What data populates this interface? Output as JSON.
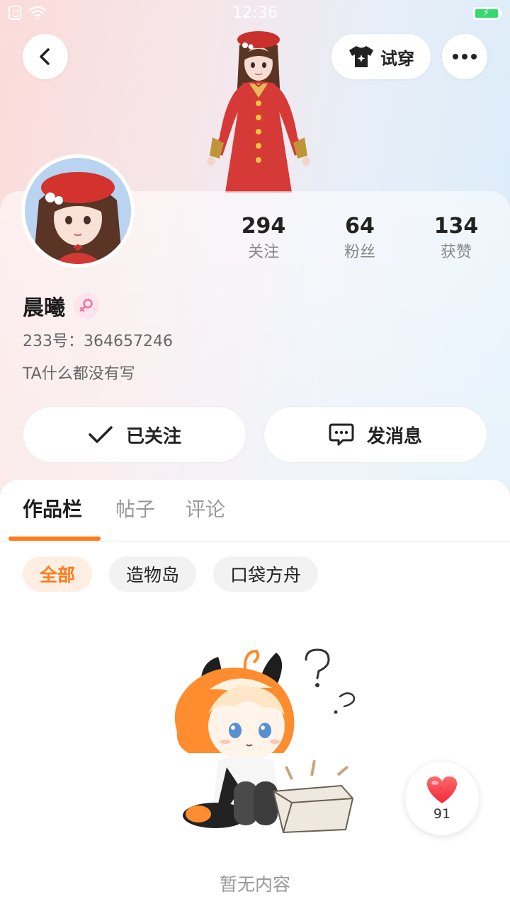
{
  "status_bar": {
    "time": "12:36"
  },
  "header": {
    "tryon_label": "试穿"
  },
  "profile": {
    "username": "晨曦",
    "uid": "233号：364657246",
    "bio": "TA什么都没有写",
    "stats": [
      {
        "value": "294",
        "label": "关注"
      },
      {
        "value": "64",
        "label": "粉丝"
      },
      {
        "value": "134",
        "label": "获赞"
      }
    ],
    "follow_button": "已关注",
    "message_button": "发消息"
  },
  "tabs": [
    "作品栏",
    "帖子",
    "评论"
  ],
  "filters": [
    "全部",
    "造物岛",
    "口袋方舟"
  ],
  "empty_text": "暂无内容",
  "likes": "91",
  "colors": {
    "accent": "#ff7a1a",
    "gender_female": "#f0709a",
    "heart": "#ff3b4a"
  }
}
